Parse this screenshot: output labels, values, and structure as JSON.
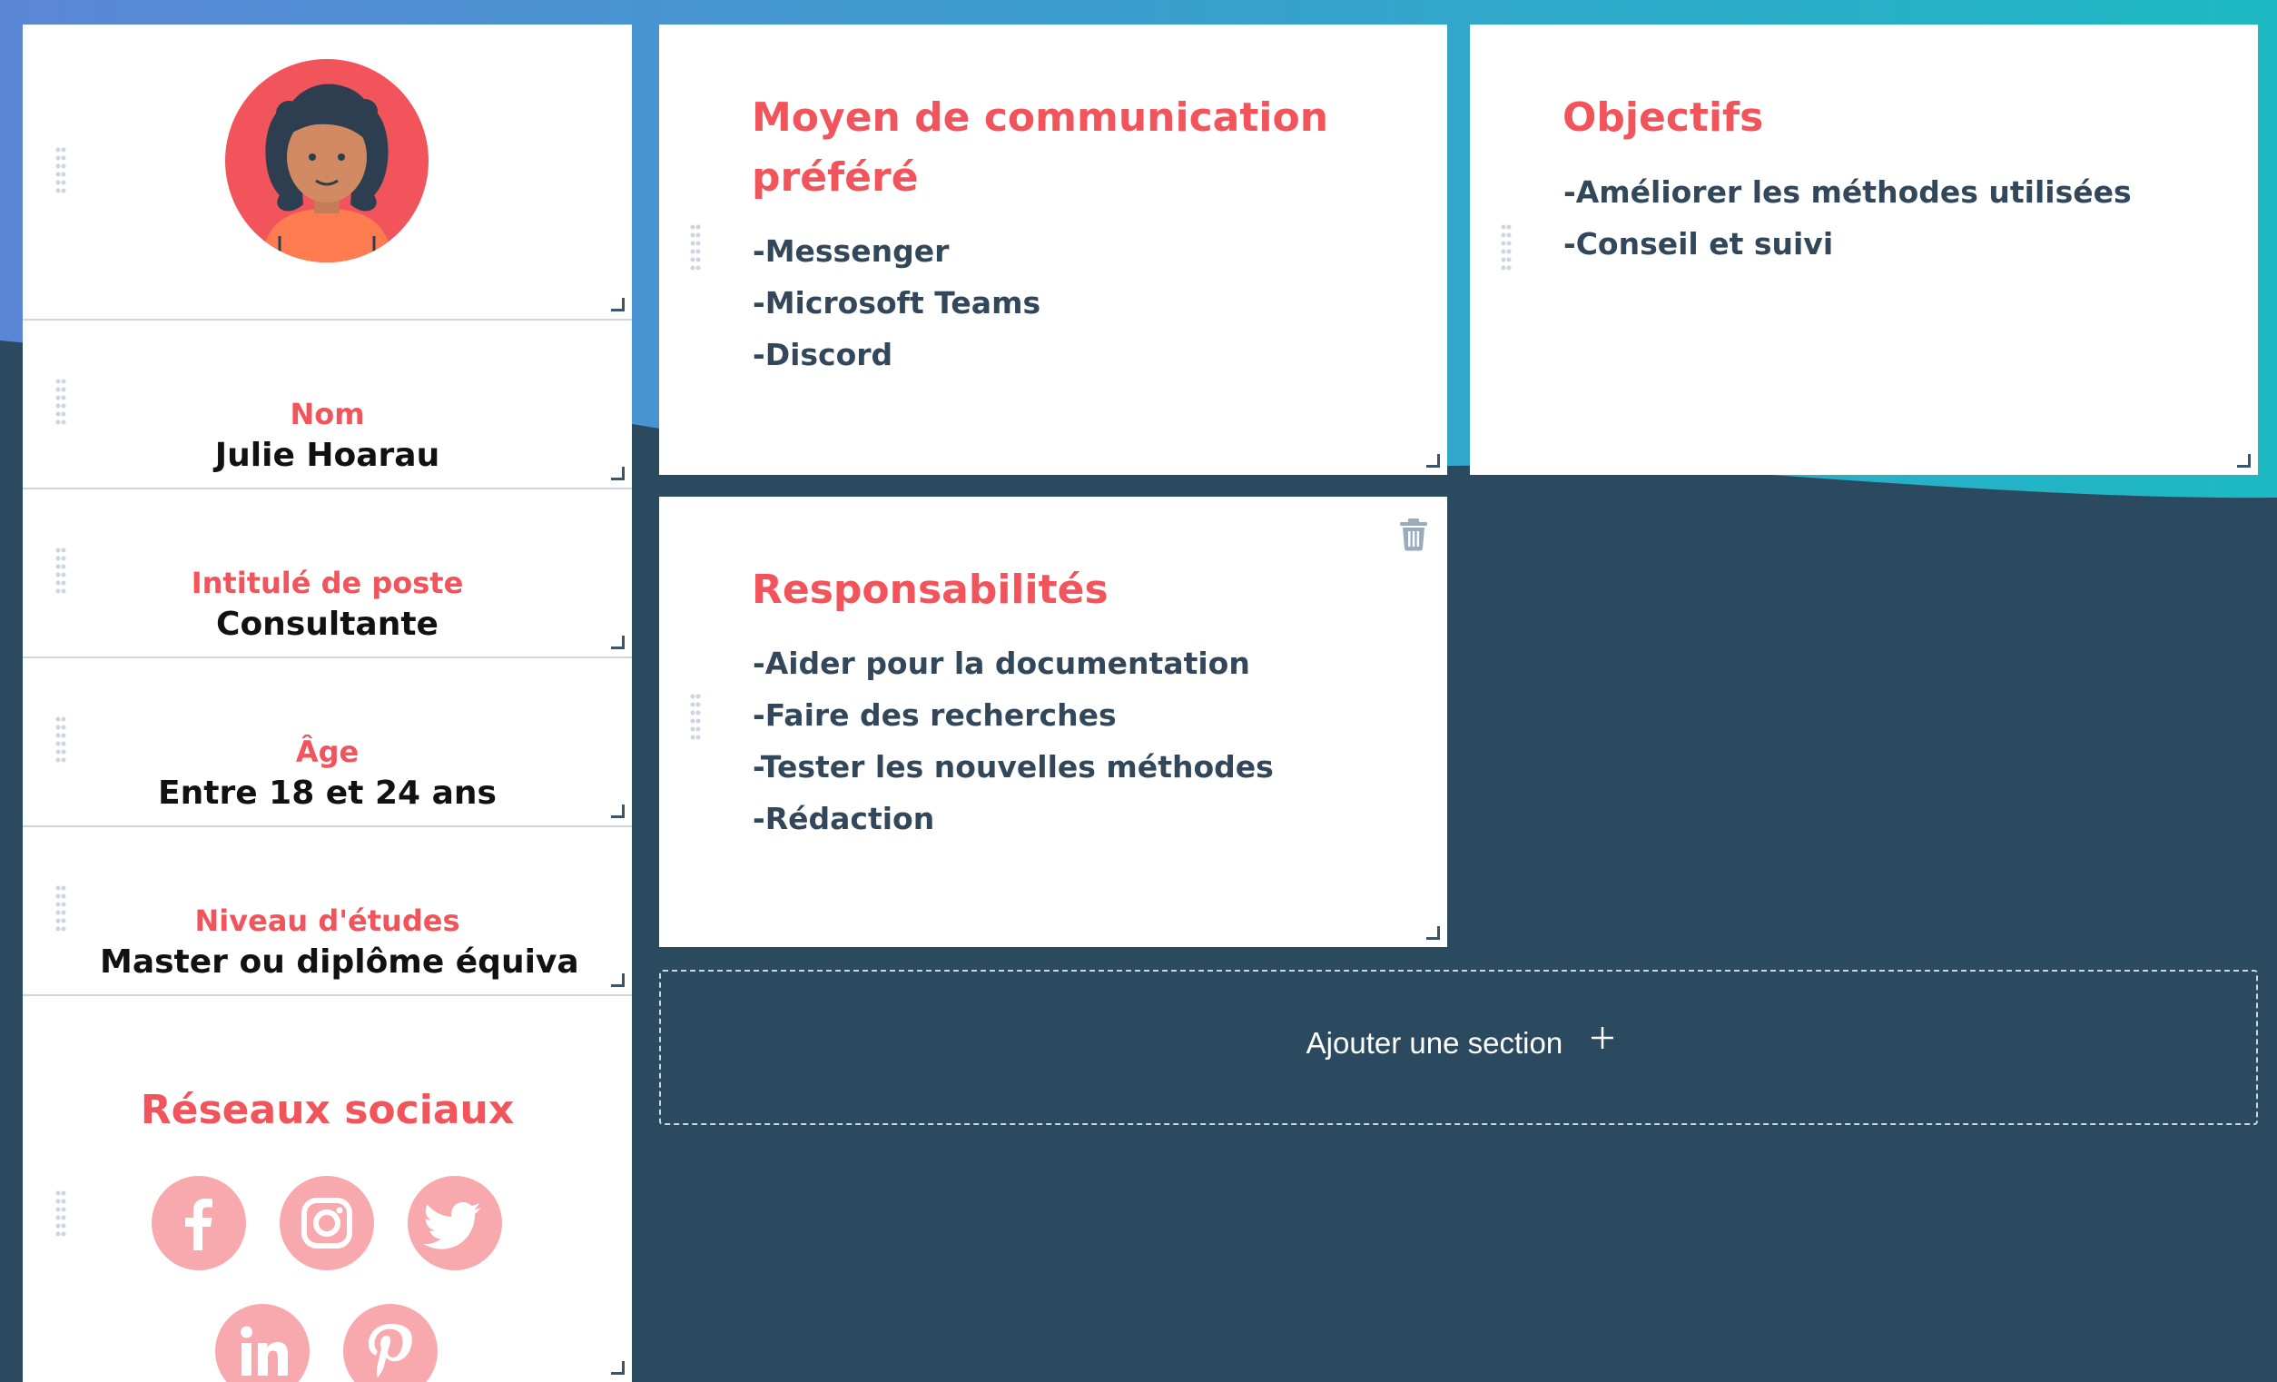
{
  "colors": {
    "accent": "#f2545b",
    "text_dark": "#33475b",
    "background": "#2c4a5f",
    "gradient_start": "#5b86d6",
    "gradient_end": "#1db9c3",
    "social_circle": "#f8a9ad"
  },
  "profile": {
    "avatar_icon": "persona-avatar-icon"
  },
  "fields": [
    {
      "label": "Nom",
      "value": "Julie Hoarau"
    },
    {
      "label": "Intitulé de poste",
      "value": "Consultante"
    },
    {
      "label": "Âge",
      "value": "Entre 18 et 24 ans"
    },
    {
      "label": "Niveau d'études",
      "value": "Master ou diplôme équival"
    }
  ],
  "social": {
    "title": "Réseaux sociaux",
    "icons": [
      "facebook-icon",
      "instagram-icon",
      "twitter-icon",
      "linkedin-icon",
      "pinterest-icon"
    ]
  },
  "cards": {
    "communication": {
      "title_line1": "Moyen de communication",
      "title_line2": "préféré",
      "items": [
        "-Messenger",
        "-Microsoft Teams",
        "-Discord"
      ]
    },
    "objectifs": {
      "title": "Objectifs",
      "items": [
        "-Améliorer les méthodes utilisées",
        "-Conseil et suivi"
      ]
    },
    "responsabilites": {
      "title": "Responsabilités",
      "items": [
        "-Aider pour la documentation",
        "-Faire des recherches",
        "-Tester les nouvelles méthodes",
        "-Rédaction"
      ]
    }
  },
  "add_section": {
    "label": "Ajouter une section",
    "icon": "plus-icon"
  }
}
